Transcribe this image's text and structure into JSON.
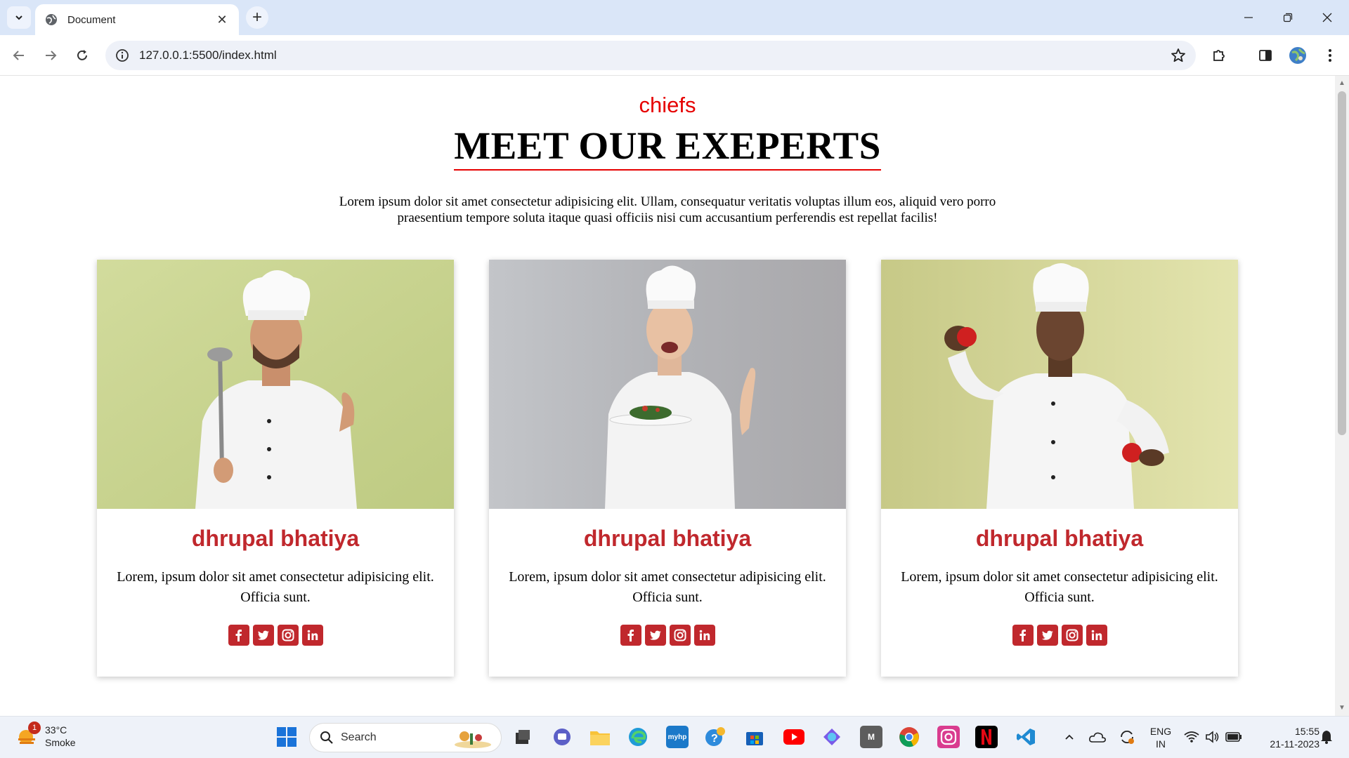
{
  "browser": {
    "tab_title": "Document",
    "url": "127.0.0.1:5500/index.html"
  },
  "page": {
    "subtitle": "chiefs",
    "heading": "MEET OUR EXEPERTS",
    "intro": "Lorem ipsum dolor sit amet consectetur adipisicing elit. Ullam, consequatur veritatis voluptas illum eos, aliquid vero porro praesentium tempore soluta itaque quasi officiis nisi cum accusantium perferendis est repellat facilis!",
    "cards": [
      {
        "name": "dhrupal bhatiya",
        "text": "Lorem, ipsum dolor sit amet consectetur adipisicing elit. Officia sunt.",
        "photo_bg": "#c9d58f"
      },
      {
        "name": "dhrupal bhatiya",
        "text": "Lorem, ipsum dolor sit amet consectetur adipisicing elit. Officia sunt.",
        "photo_bg": "#b8b9bd"
      },
      {
        "name": "dhrupal bhatiya",
        "text": "Lorem, ipsum dolor sit amet consectetur adipisicing elit. Officia sunt.",
        "photo_bg": "#d8d99a"
      }
    ],
    "social_icons": [
      "facebook-icon",
      "twitter-icon",
      "instagram-icon",
      "linkedin-icon"
    ],
    "accent_color": "#c0282d",
    "subtitle_color": "#e60000"
  },
  "taskbar": {
    "weather_badge": "1",
    "temperature": "33°C",
    "weather_condition": "Smoke",
    "search_placeholder": "Search",
    "language_line1": "ENG",
    "language_line2": "IN",
    "time": "15:55",
    "date": "21-11-2023"
  }
}
